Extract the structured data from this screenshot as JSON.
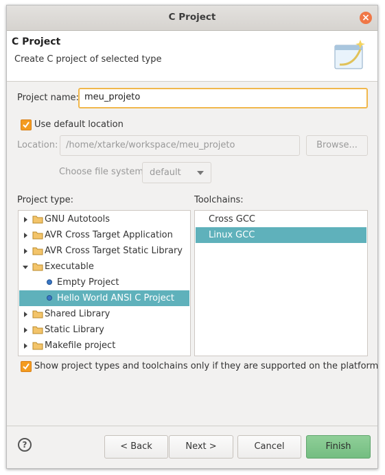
{
  "window": {
    "title": "C Project"
  },
  "banner": {
    "title": "C Project",
    "description": "Create C project of selected type"
  },
  "project_name": {
    "label": "Project name:",
    "value": "meu_projeto"
  },
  "default_location": {
    "label": "Use default location",
    "checked": true
  },
  "location": {
    "label": "Location:",
    "value": "/home/xtarke/workspace/meu_projeto",
    "browse_label": "Browse..."
  },
  "file_system": {
    "label": "Choose file system:",
    "value": "default"
  },
  "project_type": {
    "label": "Project type:",
    "items": [
      {
        "label": "GNU Autotools",
        "kind": "folder",
        "expanded": false
      },
      {
        "label": "AVR Cross Target Application",
        "kind": "folder",
        "expanded": false
      },
      {
        "label": "AVR Cross Target Static Library",
        "kind": "folder",
        "expanded": false
      },
      {
        "label": "Executable",
        "kind": "folder",
        "expanded": true
      },
      {
        "label": "Empty Project",
        "kind": "leaf"
      },
      {
        "label": "Hello World ANSI C Project",
        "kind": "leaf",
        "selected": true
      },
      {
        "label": "Shared Library",
        "kind": "folder",
        "expanded": false
      },
      {
        "label": "Static Library",
        "kind": "folder",
        "expanded": false
      },
      {
        "label": "Makefile project",
        "kind": "folder",
        "expanded": false
      }
    ]
  },
  "toolchains": {
    "label": "Toolchains:",
    "items": [
      {
        "label": "Cross GCC"
      },
      {
        "label": "Linux GCC",
        "selected": true
      }
    ]
  },
  "filter_checkbox": {
    "label": "Show project types and toolchains only if they are supported on the platform",
    "checked": true
  },
  "buttons": {
    "help": "?",
    "back": "< Back",
    "next": "Next >",
    "cancel": "Cancel",
    "finish": "Finish"
  },
  "colors": {
    "selection": "#5fb1bb",
    "accent": "#f39b1f",
    "finish": "#7ec38a",
    "close": "#f07746"
  }
}
